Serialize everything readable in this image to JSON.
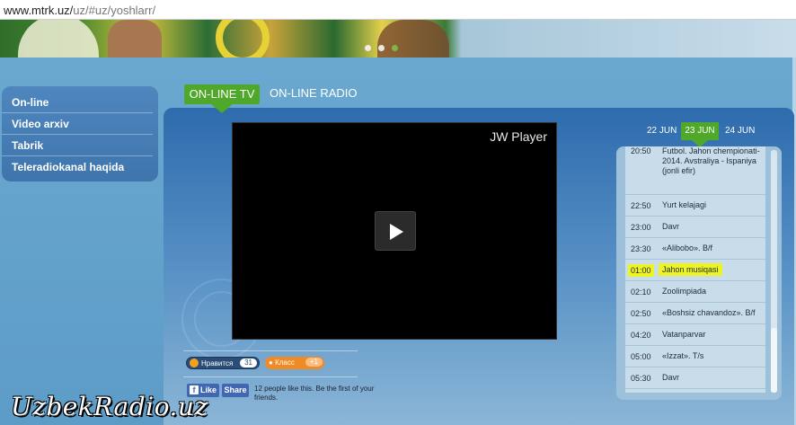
{
  "browser": {
    "url_host": "www.mtrk.uz/",
    "url_path": "uz/#uz/yoshlarr/"
  },
  "sidebar": {
    "items": [
      {
        "label": "On-line"
      },
      {
        "label": "Video arxiv"
      },
      {
        "label": "Tabrik"
      },
      {
        "label": "Teleradiokanal haqida"
      }
    ]
  },
  "tabs": {
    "tv": "ON-LINE TV",
    "radio": "ON-LINE RADIO"
  },
  "player": {
    "brand": "JW Player"
  },
  "dates": {
    "prev": "22 JUN",
    "active": "23 JUN",
    "next": "24 JUN"
  },
  "schedule": [
    {
      "time": "20:50",
      "title": "Futbol. Jahon chempionati-2014. Avstraliya - Ispaniya (jonli efir)"
    },
    {
      "time": "22:50",
      "title": "Yurt kelajagi"
    },
    {
      "time": "23:00",
      "title": "Davr"
    },
    {
      "time": "23:30",
      "title": "«Alibobo». B/f"
    },
    {
      "time": "01:00",
      "title": "Jahon musiqasi",
      "highlighted": true
    },
    {
      "time": "02:10",
      "title": "Zoolimpiada"
    },
    {
      "time": "02:50",
      "title": "«Boshsiz chavandoz». B/f"
    },
    {
      "time": "04:20",
      "title": "Vatanparvar"
    },
    {
      "time": "05:00",
      "title": "«Izzat». T/s"
    },
    {
      "time": "05:30",
      "title": "Davr"
    }
  ],
  "social": {
    "vk_label": "Нравится",
    "vk_count": "31",
    "ok_label": "Класс",
    "ok_count": "+1",
    "fb_like": "Like",
    "fb_share": "Share",
    "fb_text": "12 people like this. Be the first of your friends."
  },
  "watermark": "UzbekRadio.uz",
  "colors": {
    "accent_green": "#4fa82a",
    "panel_blue": "#2e6bad",
    "highlight": "#eef322"
  }
}
